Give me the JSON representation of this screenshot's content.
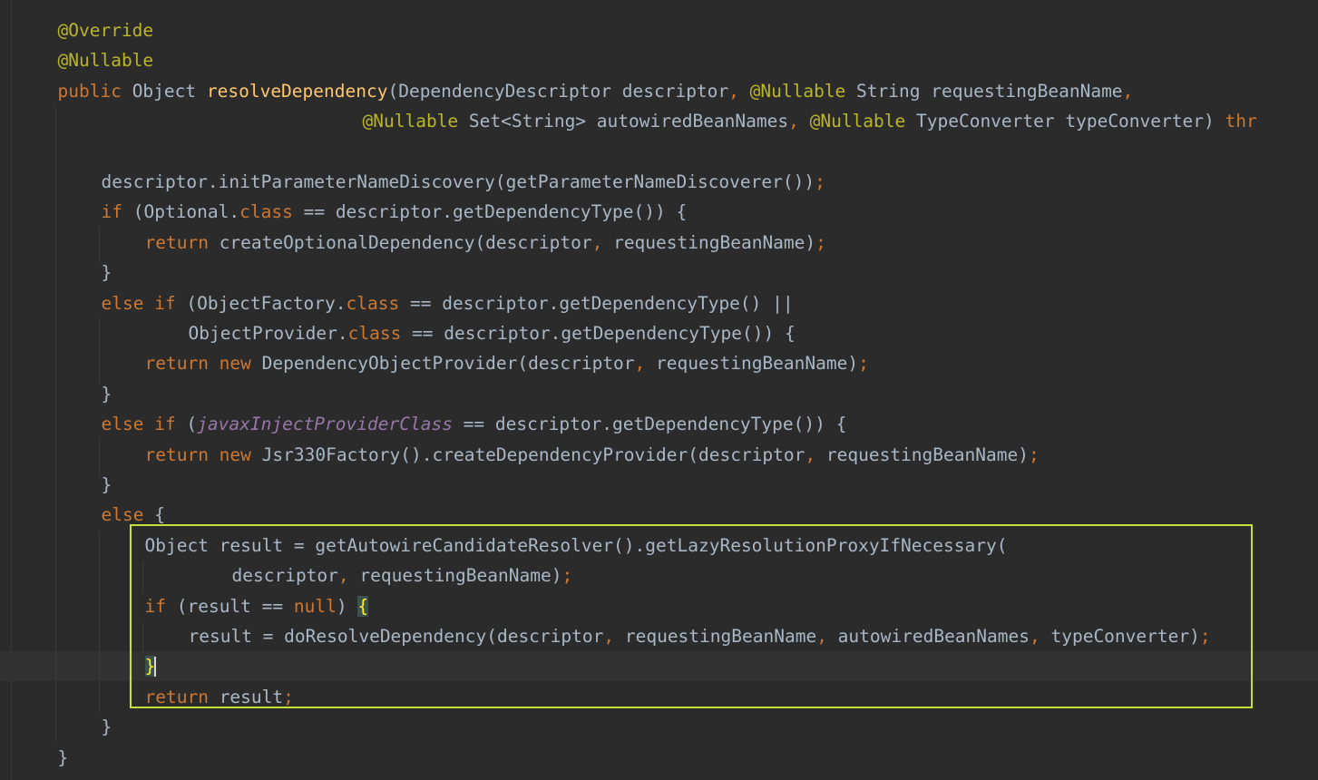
{
  "editor": {
    "lines": [
      {
        "indent": 1,
        "tokens": [
          [
            "a",
            "@Override"
          ]
        ]
      },
      {
        "indent": 1,
        "tokens": [
          [
            "a",
            "@Nullable"
          ]
        ]
      },
      {
        "indent": 1,
        "tokens": [
          [
            "k",
            "public "
          ],
          [
            "t",
            "Object "
          ],
          [
            "m",
            "resolveDependency"
          ],
          [
            "t",
            "(DependencyDescriptor descriptor"
          ],
          [
            "p",
            ", "
          ],
          [
            "a",
            "@Nullable "
          ],
          [
            "t",
            "String requestingBeanName"
          ],
          [
            "p",
            ","
          ]
        ]
      },
      {
        "indent": 8,
        "tokens": [
          [
            "a",
            "@Nullable "
          ],
          [
            "t",
            "Set<String> autowiredBeanNames"
          ],
          [
            "p",
            ", "
          ],
          [
            "a",
            "@Nullable "
          ],
          [
            "t",
            "TypeConverter typeConverter) "
          ],
          [
            "k",
            "thr"
          ]
        ]
      },
      {
        "indent": 0,
        "tokens": []
      },
      {
        "indent": 2,
        "tokens": [
          [
            "t",
            "descriptor.initParameterNameDiscovery(getParameterNameDiscoverer())"
          ],
          [
            "p",
            ";"
          ]
        ]
      },
      {
        "indent": 2,
        "tokens": [
          [
            "k",
            "if "
          ],
          [
            "t",
            "(Optional."
          ],
          [
            "k",
            "class "
          ],
          [
            "t",
            "== descriptor.getDependencyType()) {"
          ]
        ]
      },
      {
        "indent": 3,
        "tokens": [
          [
            "k",
            "return "
          ],
          [
            "t",
            "createOptionalDependency(descriptor"
          ],
          [
            "p",
            ", "
          ],
          [
            "t",
            "requestingBeanName)"
          ],
          [
            "p",
            ";"
          ]
        ]
      },
      {
        "indent": 2,
        "tokens": [
          [
            "t",
            "}"
          ]
        ]
      },
      {
        "indent": 2,
        "tokens": [
          [
            "k",
            "else if "
          ],
          [
            "t",
            "(ObjectFactory."
          ],
          [
            "k",
            "class "
          ],
          [
            "t",
            "== descriptor.getDependencyType() ||"
          ]
        ]
      },
      {
        "indent": 4,
        "tokens": [
          [
            "t",
            "ObjectProvider."
          ],
          [
            "k",
            "class "
          ],
          [
            "t",
            "== descriptor.getDependencyType()) {"
          ]
        ]
      },
      {
        "indent": 3,
        "tokens": [
          [
            "k",
            "return new "
          ],
          [
            "t",
            "DependencyObjectProvider(descriptor"
          ],
          [
            "p",
            ", "
          ],
          [
            "t",
            "requestingBeanName)"
          ],
          [
            "p",
            ";"
          ]
        ]
      },
      {
        "indent": 2,
        "tokens": [
          [
            "t",
            "}"
          ]
        ]
      },
      {
        "indent": 2,
        "tokens": [
          [
            "k",
            "else if "
          ],
          [
            "t",
            "("
          ],
          [
            "f",
            "javaxInjectProviderClass"
          ],
          [
            "t",
            " == descriptor.getDependencyType()) {"
          ]
        ]
      },
      {
        "indent": 3,
        "tokens": [
          [
            "k",
            "return new "
          ],
          [
            "t",
            "Jsr330Factory().createDependencyProvider(descriptor"
          ],
          [
            "p",
            ", "
          ],
          [
            "t",
            "requestingBeanName)"
          ],
          [
            "p",
            ";"
          ]
        ]
      },
      {
        "indent": 2,
        "tokens": [
          [
            "t",
            "}"
          ]
        ]
      },
      {
        "indent": 2,
        "tokens": [
          [
            "k",
            "else "
          ],
          [
            "t",
            "{"
          ]
        ]
      },
      {
        "indent": 3,
        "tokens": [
          [
            "t",
            "Object result = getAutowireCandidateResolver().getLazyResolutionProxyIfNecessary("
          ]
        ]
      },
      {
        "indent": 5,
        "tokens": [
          [
            "t",
            "descriptor"
          ],
          [
            "p",
            ", "
          ],
          [
            "t",
            "requestingBeanName)"
          ],
          [
            "p",
            ";"
          ]
        ]
      },
      {
        "indent": 3,
        "tokens": [
          [
            "k",
            "if "
          ],
          [
            "t",
            "(result == "
          ],
          [
            "k",
            "null"
          ],
          [
            "t",
            ") "
          ],
          [
            "bm",
            "{"
          ]
        ]
      },
      {
        "indent": 4,
        "tokens": [
          [
            "t",
            "result = doResolveDependency(descriptor"
          ],
          [
            "p",
            ", "
          ],
          [
            "t",
            "requestingBeanName"
          ],
          [
            "p",
            ", "
          ],
          [
            "t",
            "autowiredBeanNames"
          ],
          [
            "p",
            ", "
          ],
          [
            "t",
            "typeConverter)"
          ],
          [
            "p",
            ";"
          ]
        ]
      },
      {
        "indent": 3,
        "tokens": [
          [
            "bm",
            "}"
          ]
        ]
      },
      {
        "indent": 3,
        "tokens": [
          [
            "k",
            "return "
          ],
          [
            "t",
            "result"
          ],
          [
            "p",
            ";"
          ]
        ]
      },
      {
        "indent": 2,
        "tokens": [
          [
            "t",
            "}"
          ]
        ]
      },
      {
        "indent": 1,
        "tokens": [
          [
            "t",
            "}"
          ]
        ]
      }
    ]
  }
}
